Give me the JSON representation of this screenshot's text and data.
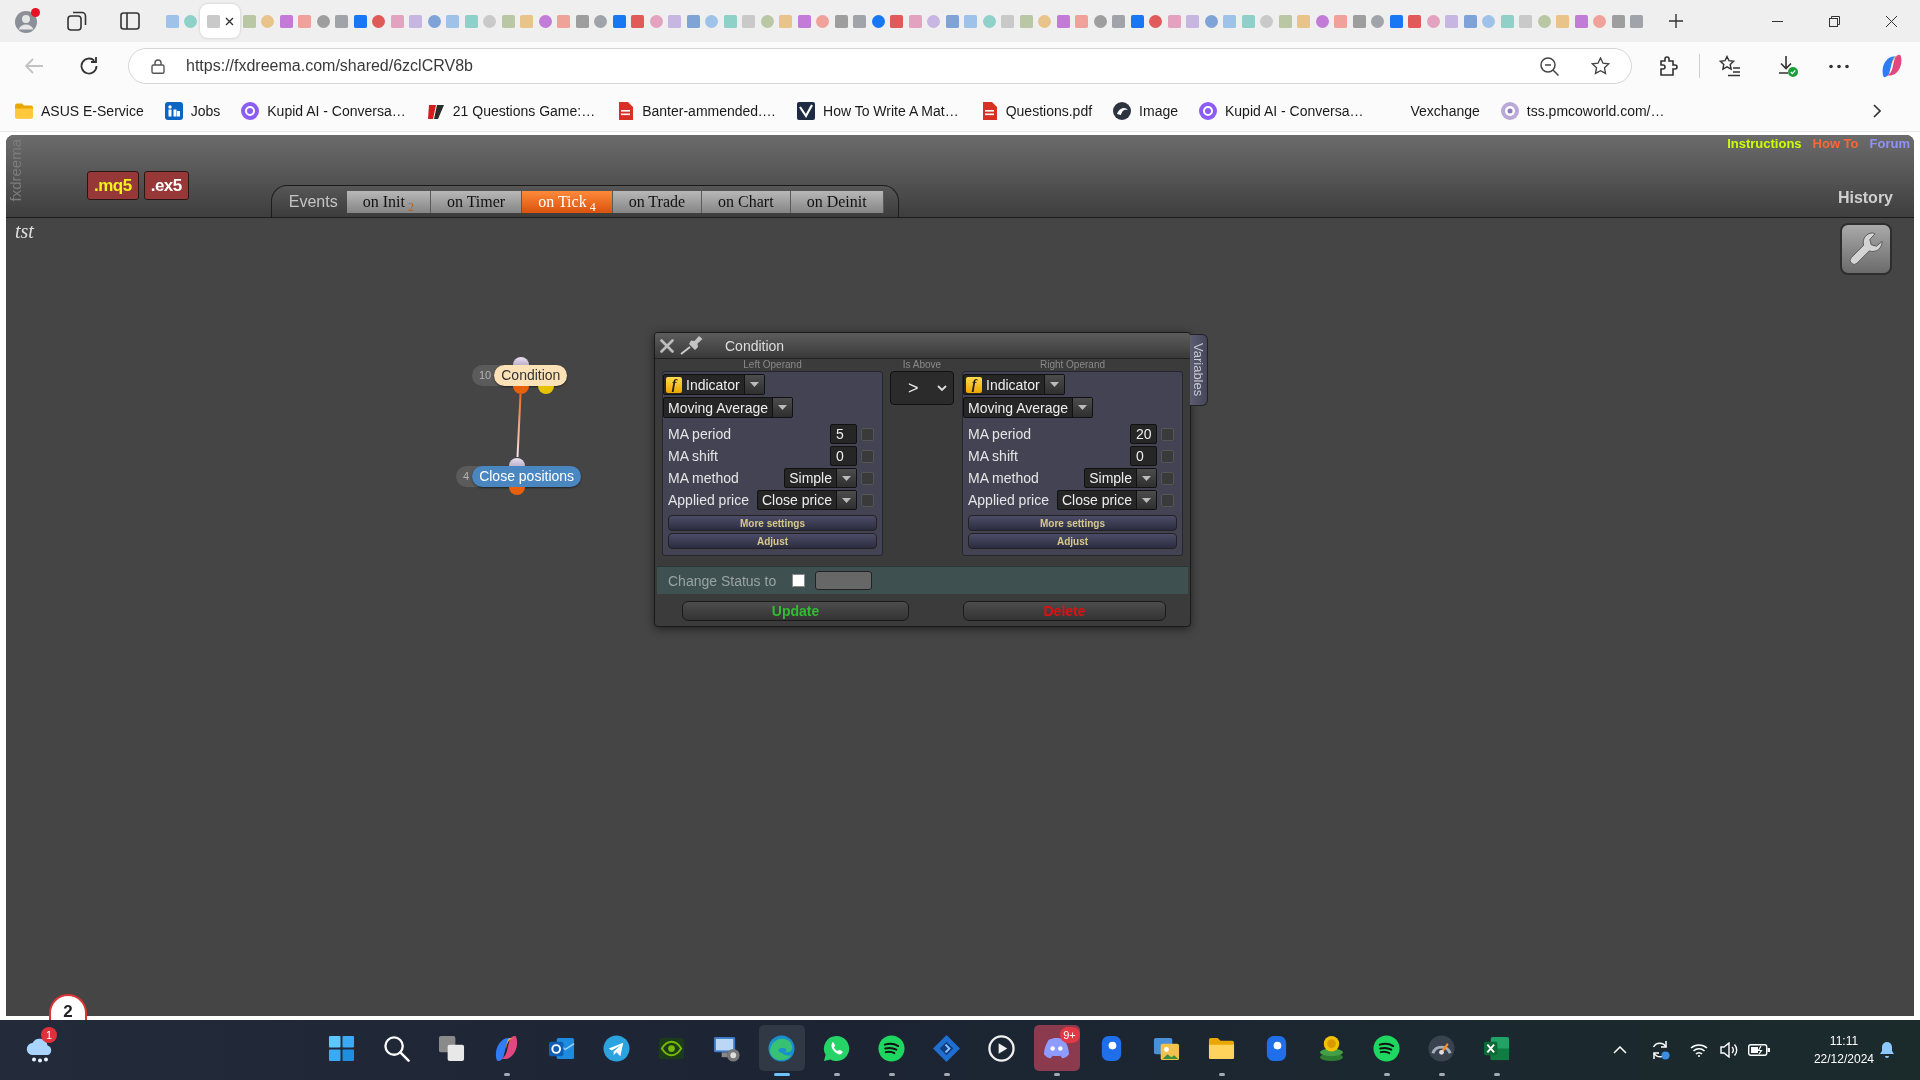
{
  "browser": {
    "tabs": [
      {
        "selected": false
      },
      {
        "selected": false
      },
      {
        "selected": true
      },
      {
        "selected": false
      },
      {
        "selected": false
      },
      {
        "selected": false
      },
      {
        "selected": false
      },
      {
        "selected": false
      },
      {
        "selected": false
      },
      {
        "selected": false
      },
      {
        "selected": false
      },
      {
        "selected": false
      },
      {
        "selected": false
      },
      {
        "selected": false
      },
      {
        "selected": false
      },
      {
        "selected": false
      },
      {
        "selected": false
      },
      {
        "selected": false
      },
      {
        "selected": false
      },
      {
        "selected": false
      },
      {
        "selected": false
      },
      {
        "selected": false
      },
      {
        "selected": false
      },
      {
        "selected": false
      },
      {
        "selected": false
      },
      {
        "selected": false
      },
      {
        "selected": false
      },
      {
        "selected": false
      },
      {
        "selected": false
      },
      {
        "selected": false
      },
      {
        "selected": false
      },
      {
        "selected": false
      },
      {
        "selected": false
      },
      {
        "selected": false
      },
      {
        "selected": false
      },
      {
        "selected": false
      },
      {
        "selected": false
      },
      {
        "selected": false
      },
      {
        "selected": false
      },
      {
        "selected": false
      },
      {
        "selected": false
      },
      {
        "selected": false
      },
      {
        "selected": false
      },
      {
        "selected": false
      },
      {
        "selected": false
      },
      {
        "selected": false
      },
      {
        "selected": false
      },
      {
        "selected": false
      },
      {
        "selected": false
      },
      {
        "selected": false
      },
      {
        "selected": false
      },
      {
        "selected": false
      },
      {
        "selected": false
      },
      {
        "selected": false
      },
      {
        "selected": false
      },
      {
        "selected": false
      },
      {
        "selected": false
      },
      {
        "selected": false
      },
      {
        "selected": false
      },
      {
        "selected": false
      },
      {
        "selected": false
      },
      {
        "selected": false
      },
      {
        "selected": false
      },
      {
        "selected": false
      },
      {
        "selected": false
      },
      {
        "selected": false
      },
      {
        "selected": false
      },
      {
        "selected": false
      },
      {
        "selected": false
      },
      {
        "selected": false
      },
      {
        "selected": false
      },
      {
        "selected": false
      },
      {
        "selected": false
      },
      {
        "selected": false
      },
      {
        "selected": false
      },
      {
        "selected": false
      },
      {
        "selected": false
      },
      {
        "selected": false
      },
      {
        "selected": false
      }
    ],
    "url": "https://fxdreema.com/shared/6zclCRV8b",
    "bookmarks": [
      {
        "label": "ASUS E-Service",
        "kind": "folder"
      },
      {
        "label": "Jobs",
        "kind": "link"
      },
      {
        "label": "Kupid AI - Conversa…",
        "kind": "link"
      },
      {
        "label": "21 Questions Game:…",
        "kind": "link"
      },
      {
        "label": "Banter-ammended.…",
        "kind": "link"
      },
      {
        "label": "How To Write A Mat…",
        "kind": "link"
      },
      {
        "label": "Questions.pdf",
        "kind": "link"
      },
      {
        "label": "Image",
        "kind": "link"
      },
      {
        "label": "Kupid AI - Conversa…",
        "kind": "link"
      },
      {
        "label": "Vexchange",
        "kind": "link"
      },
      {
        "label": "tss.pmcoworld.com/…",
        "kind": "link"
      }
    ]
  },
  "app": {
    "side_label": "fxdreema",
    "file_buttons": [
      {
        "label": ".mq5",
        "kind": "source"
      },
      {
        "label": ".ex5",
        "kind": "compiled"
      }
    ],
    "events": {
      "label": "Events",
      "tabs": [
        {
          "label": "on Init",
          "count": "2",
          "selected": false
        },
        {
          "label": "on Timer",
          "selected": false
        },
        {
          "label": "on Tick",
          "count": "4",
          "selected": true
        },
        {
          "label": "on Trade",
          "selected": false
        },
        {
          "label": "on Chart",
          "selected": false
        },
        {
          "label": "on Deinit",
          "selected": false
        }
      ]
    },
    "links": [
      {
        "label": "Instructions",
        "color": "#ccff00"
      },
      {
        "label": "How To",
        "color": "#ff6633"
      },
      {
        "label": "Forum",
        "color": "#9090ff"
      }
    ],
    "history": "History",
    "project": "tst",
    "nodes": [
      {
        "number": "10",
        "label": "Condition",
        "kind": "condition"
      },
      {
        "number": "4",
        "label": "Close positions",
        "kind": "action"
      }
    ],
    "dialog": {
      "title": "Condition",
      "side_tab": "Variables",
      "left": {
        "label": "Left Operand",
        "source_glyph": "f",
        "source": "Indicator",
        "indicator": "Moving Average",
        "params": [
          {
            "label": "MA period",
            "kind": "input",
            "value": "5",
            "checked": false
          },
          {
            "label": "MA shift",
            "kind": "input",
            "value": "0",
            "checked": false
          },
          {
            "label": "MA method",
            "kind": "select",
            "value": "Simple",
            "checked": false
          },
          {
            "label": "Applied price",
            "kind": "select",
            "value": "Close price",
            "checked": false
          }
        ],
        "buttons": [
          "More settings",
          "Adjust"
        ]
      },
      "operator": {
        "label": "Is Above",
        "value": ">"
      },
      "right": {
        "label": "Right Operand",
        "source_glyph": "f",
        "source": "Indicator",
        "indicator": "Moving Average",
        "params": [
          {
            "label": "MA period",
            "kind": "input",
            "value": "20",
            "checked": false
          },
          {
            "label": "MA shift",
            "kind": "input",
            "value": "0",
            "checked": false
          },
          {
            "label": "MA method",
            "kind": "select",
            "value": "Simple",
            "checked": false
          },
          {
            "label": "Applied price",
            "kind": "select",
            "value": "Close price",
            "checked": false
          }
        ],
        "buttons": [
          "More settings",
          "Adjust"
        ]
      },
      "status": {
        "label": "Change Status to",
        "checked": false
      },
      "actions": [
        {
          "label": "Update",
          "color": "#33bb33"
        },
        {
          "label": "Delete",
          "color": "#dd1111"
        }
      ]
    }
  },
  "notification_badge": "2",
  "taskbar": {
    "weather_badge": "1",
    "apps": [
      {
        "running": false,
        "active": false,
        "attention": false
      },
      {
        "running": false,
        "active": false,
        "attention": false
      },
      {
        "running": false,
        "active": false,
        "attention": false
      },
      {
        "running": true,
        "active": false,
        "attention": false
      },
      {
        "running": false,
        "active": false,
        "attention": false
      },
      {
        "running": false,
        "active": false,
        "attention": false
      },
      {
        "running": false,
        "active": false,
        "attention": false
      },
      {
        "running": false,
        "active": false,
        "attention": false
      },
      {
        "running": true,
        "active": true,
        "attention": false
      },
      {
        "running": true,
        "active": false,
        "attention": false
      },
      {
        "running": true,
        "active": false,
        "attention": false
      },
      {
        "running": true,
        "active": false,
        "attention": false
      },
      {
        "running": false,
        "active": false,
        "attention": false
      },
      {
        "running": true,
        "active": false,
        "attention": true,
        "badge": "9+"
      },
      {
        "running": false,
        "active": false,
        "attention": false
      },
      {
        "running": false,
        "active": false,
        "attention": false
      },
      {
        "running": true,
        "active": false,
        "attention": false
      },
      {
        "running": false,
        "active": false,
        "attention": false
      },
      {
        "running": false,
        "active": false,
        "attention": false
      },
      {
        "running": true,
        "active": false,
        "attention": false
      },
      {
        "running": true,
        "active": false,
        "attention": false
      },
      {
        "running": true,
        "active": false,
        "attention": false
      }
    ],
    "time": "11:11",
    "date": "22/12/2024"
  }
}
